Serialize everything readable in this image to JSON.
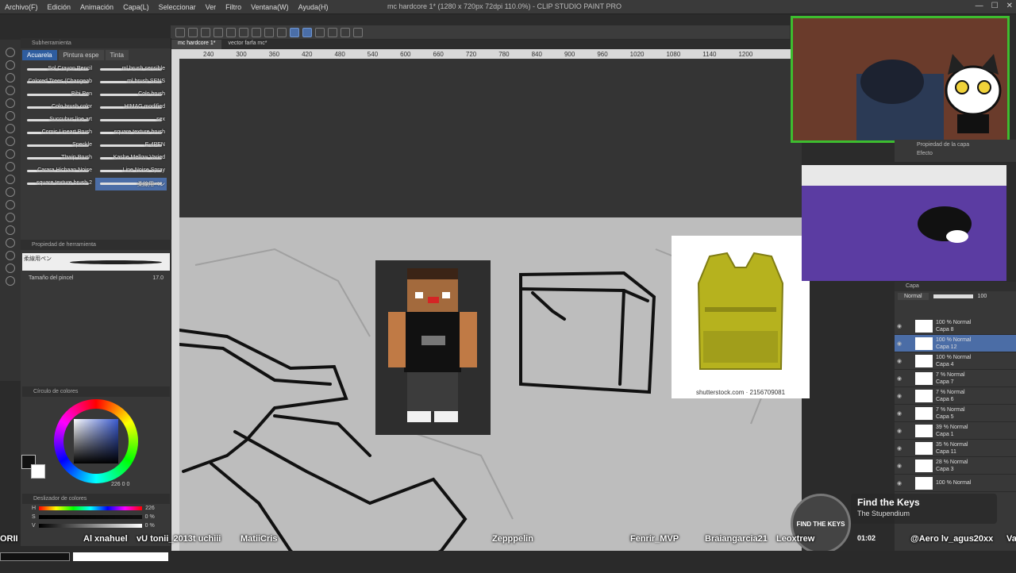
{
  "app": {
    "title": "mc hardcore 1* (1280 x 720px 72dpi 110.0%) - CLIP STUDIO PAINT PRO",
    "menu": [
      "Archivo(F)",
      "Edición",
      "Animación",
      "Capa(L)",
      "Seleccionar",
      "Ver",
      "Filtro",
      "Ventana(W)",
      "Ayuda(H)"
    ]
  },
  "doc_tabs": [
    "mc hardcore 1*",
    "vector farfa mc*"
  ],
  "ruler_ticks": [
    "240",
    "300",
    "360",
    "420",
    "480",
    "540",
    "600",
    "660",
    "720",
    "780",
    "840",
    "900",
    "960",
    "1020",
    "1080",
    "1140",
    "1200"
  ],
  "subtool_panel": {
    "title": "Subherramienta",
    "tabs": [
      "Acuarela",
      "Pintura espe",
      "Tinta"
    ],
    "active_tab": "Acuarela",
    "brushes": [
      "Sol Crayon Pencil",
      "ml brush sensible",
      "Colored Trees (Changeab",
      "ml brush SENS",
      "Bibi Pen",
      "Colo brush",
      "Colo brush color",
      "HIMAG modified",
      "Succubus line art",
      "sex",
      "Comic Lineart Brush",
      "square texture brush",
      "Speckle",
      "E-4PEN",
      "Thwip Brush",
      "Kashe Mellow Varied",
      "Carara Hichaan Noise",
      "Line Noise Spray",
      "square texture brush 2",
      "柔線用ペン"
    ],
    "selected_brush": "柔線用ペン"
  },
  "tool_property": {
    "title": "Propiedad de herramienta",
    "brush_name": "柔線用ペン",
    "size_label": "Tamaño del pincel",
    "size_value": "17.0"
  },
  "color_wheel": {
    "title": "Círculo de colores",
    "readout": "226  0  0"
  },
  "color_slider": {
    "title": "Deslizador de colores",
    "rows": [
      {
        "label": "H",
        "value": "226"
      },
      {
        "label": "S",
        "value": "0 %"
      },
      {
        "label": "V",
        "value": "0 %"
      }
    ]
  },
  "reference": {
    "caption": "shutterstock.com · 2156709081"
  },
  "layers": {
    "panel_title": "Capa",
    "property_title": "Propiedad de la capa",
    "effect_label": "Efecto",
    "blend_mode": "Normal",
    "opacity": "100",
    "items": [
      {
        "pct": "100 % Normal",
        "name": "Capa 8"
      },
      {
        "pct": "100 % Normal",
        "name": "Capa 12"
      },
      {
        "pct": "100 % Normal",
        "name": "Capa 4"
      },
      {
        "pct": "7 % Normal",
        "name": "Capa 7"
      },
      {
        "pct": "7 % Normal",
        "name": "Capa 6"
      },
      {
        "pct": "7 % Normal",
        "name": "Capa 5"
      },
      {
        "pct": "39 % Normal",
        "name": "Capa 1"
      },
      {
        "pct": "35 % Normal",
        "name": "Capa 11"
      },
      {
        "pct": "28 % Normal",
        "name": "Capa 3"
      },
      {
        "pct": "100 % Normal",
        "name": ""
      }
    ],
    "selected_index": 1
  },
  "music": {
    "title": "Find the Keys",
    "artist": "The Stupendium",
    "time": "01:02",
    "badge": "FIND THE KEYS"
  },
  "chat_names": [
    "ORII",
    "Al  xnahuel",
    "vU  tonii_2013t  uchiii",
    "MatiiCris",
    "Zepppelin",
    "Fenrir_MVP",
    "Braiangarcia21",
    "Leoxtrew",
    "@Aero  lv_agus20xx",
    "Va"
  ],
  "colors": {
    "accent": "#4b6da6",
    "webcam_border": "#3dbd2f",
    "canvas_paper": "#bdbdbd"
  }
}
